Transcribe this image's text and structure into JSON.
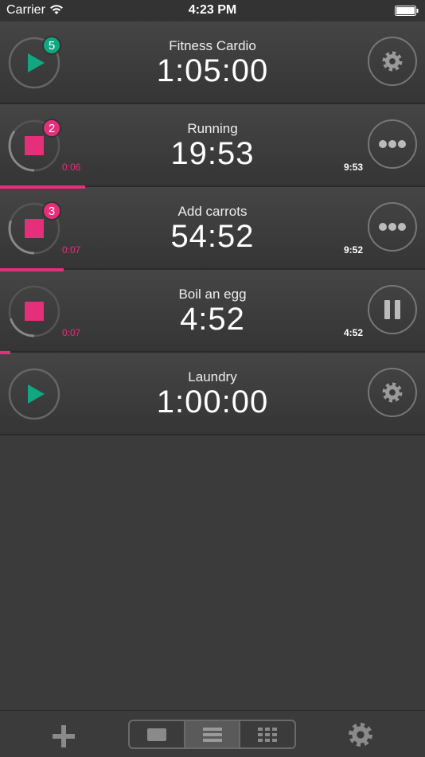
{
  "status_bar": {
    "carrier": "Carrier",
    "time": "4:23 PM"
  },
  "colors": {
    "accent_pink": "#e52f7a",
    "accent_green": "#11a780",
    "ring_gray": "#888888"
  },
  "timers": [
    {
      "name": "Fitness Cardio",
      "countdown": "1:05:00",
      "state": "idle",
      "badge": "5",
      "badge_color": "green",
      "elapsed": "",
      "total": "",
      "action_icon": "gear-icon",
      "ring_progress": 1.0,
      "bar_progress": 0
    },
    {
      "name": "Running",
      "countdown": "19:53",
      "state": "running",
      "badge": "2",
      "badge_color": "pink",
      "elapsed": "0:06",
      "total": "9:53",
      "action_icon": "more-icon",
      "ring_progress": 0.35,
      "bar_progress": 0.2
    },
    {
      "name": "Add carrots",
      "countdown": "54:52",
      "state": "running",
      "badge": "3",
      "badge_color": "pink",
      "elapsed": "0:07",
      "total": "9:52",
      "action_icon": "more-icon",
      "ring_progress": 0.3,
      "bar_progress": 0.15
    },
    {
      "name": "Boil an egg",
      "countdown": "4:52",
      "state": "running",
      "badge": "",
      "badge_color": "",
      "elapsed": "0:07",
      "total": "4:52",
      "action_icon": "pause-icon",
      "ring_progress": 0.2,
      "bar_progress": 0.025
    },
    {
      "name": "Laundry",
      "countdown": "1:00:00",
      "state": "idle",
      "badge": "",
      "badge_color": "",
      "elapsed": "",
      "total": "",
      "action_icon": "gear-icon",
      "ring_progress": 1.0,
      "bar_progress": 0
    }
  ],
  "toolbar": {
    "add_icon": "plus-icon",
    "settings_icon": "gear-icon",
    "views": [
      {
        "icon": "single-view-icon",
        "active": false
      },
      {
        "icon": "list-view-icon",
        "active": true
      },
      {
        "icon": "grid-view-icon",
        "active": false
      }
    ]
  }
}
